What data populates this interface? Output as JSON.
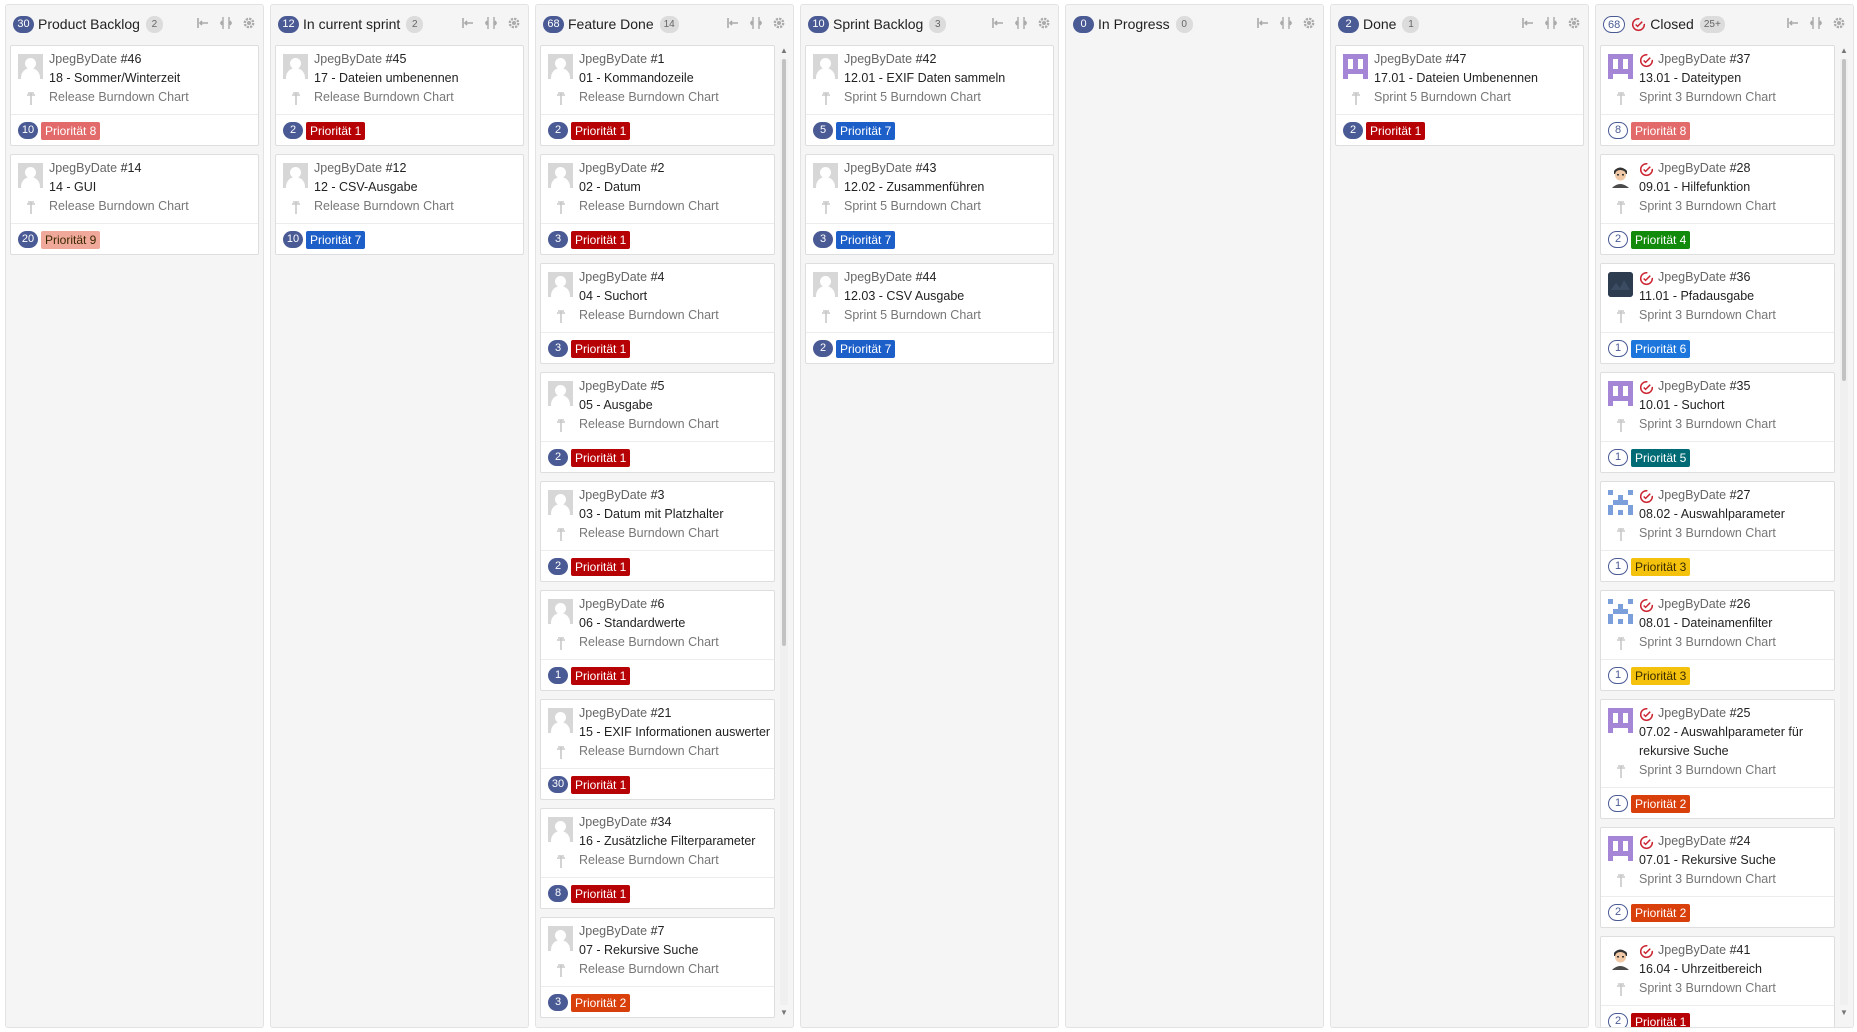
{
  "columns": [
    {
      "count": "30",
      "title": "Product Backlog",
      "badge": "2",
      "cards": [
        {
          "repo": "JpegByDate",
          "num": "#46",
          "title": "18 - Sommer/Winterzeit",
          "milestone": "Release Burndown Chart",
          "points": "10",
          "priority": "Priorität 8",
          "prio_color": "#e26a6a",
          "avatar": "gray"
        },
        {
          "repo": "JpegByDate",
          "num": "#14",
          "title": "14 - GUI",
          "milestone": "Release Burndown Chart",
          "points": "20",
          "priority": "Priorität 9",
          "prio_color": "#f0a89a",
          "avatar": "gray"
        }
      ]
    },
    {
      "count": "12",
      "title": "In current sprint",
      "badge": "2",
      "cards": [
        {
          "repo": "JpegByDate",
          "num": "#45",
          "title": "17 - Dateien umbenennen",
          "milestone": "Release Burndown Chart",
          "points": "2",
          "priority": "Priorität 1",
          "prio_color": "#b60205",
          "avatar": "gray"
        },
        {
          "repo": "JpegByDate",
          "num": "#12",
          "title": "12 - CSV-Ausgabe",
          "milestone": "Release Burndown Chart",
          "points": "10",
          "priority": "Priorität 7",
          "prio_color": "#1d5fc8",
          "avatar": "gray"
        }
      ]
    },
    {
      "count": "68",
      "title": "Feature Done",
      "badge": "14",
      "cards": [
        {
          "repo": "JpegByDate",
          "num": "#1",
          "title": "01 - Kommandozeile",
          "milestone": "Release Burndown Chart",
          "points": "2",
          "priority": "Priorität 1",
          "prio_color": "#b60205",
          "avatar": "gray"
        },
        {
          "repo": "JpegByDate",
          "num": "#2",
          "title": "02 - Datum",
          "milestone": "Release Burndown Chart",
          "points": "3",
          "priority": "Priorität 1",
          "prio_color": "#b60205",
          "avatar": "gray"
        },
        {
          "repo": "JpegByDate",
          "num": "#4",
          "title": "04 - Suchort",
          "milestone": "Release Burndown Chart",
          "points": "3",
          "priority": "Priorität 1",
          "prio_color": "#b60205",
          "avatar": "gray"
        },
        {
          "repo": "JpegByDate",
          "num": "#5",
          "title": "05 - Ausgabe",
          "milestone": "Release Burndown Chart",
          "points": "2",
          "priority": "Priorität 1",
          "prio_color": "#b60205",
          "avatar": "gray"
        },
        {
          "repo": "JpegByDate",
          "num": "#3",
          "title": "03 - Datum mit Platzhalter",
          "milestone": "Release Burndown Chart",
          "points": "2",
          "priority": "Priorität 1",
          "prio_color": "#b60205",
          "avatar": "gray"
        },
        {
          "repo": "JpegByDate",
          "num": "#6",
          "title": "06 - Standardwerte",
          "milestone": "Release Burndown Chart",
          "points": "1",
          "priority": "Priorität 1",
          "prio_color": "#b60205",
          "avatar": "gray"
        },
        {
          "repo": "JpegByDate",
          "num": "#21",
          "title": "15 - EXIF Informationen auswerten",
          "milestone": "Release Burndown Chart",
          "points": "30",
          "priority": "Priorität 1",
          "prio_color": "#b60205",
          "avatar": "gray"
        },
        {
          "repo": "JpegByDate",
          "num": "#34",
          "title": "16 - Zusätzliche Filterparameter",
          "milestone": "Release Burndown Chart",
          "points": "8",
          "priority": "Priorität 1",
          "prio_color": "#b60205",
          "avatar": "gray"
        },
        {
          "repo": "JpegByDate",
          "num": "#7",
          "title": "07 - Rekursive Suche",
          "milestone": "Release Burndown Chart",
          "points": "3",
          "priority": "Priorität 2",
          "prio_color": "#d93f0b",
          "avatar": "gray"
        }
      ]
    },
    {
      "count": "10",
      "title": "Sprint Backlog",
      "badge": "3",
      "cards": [
        {
          "repo": "JpegByDate",
          "num": "#42",
          "title": "12.01 - EXIF Daten sammeln",
          "milestone": "Sprint 5 Burndown Chart",
          "points": "5",
          "priority": "Priorität 7",
          "prio_color": "#1d5fc8",
          "avatar": "gray"
        },
        {
          "repo": "JpegByDate",
          "num": "#43",
          "title": "12.02 - Zusammenführen",
          "milestone": "Sprint 5 Burndown Chart",
          "points": "3",
          "priority": "Priorität 7",
          "prio_color": "#1d5fc8",
          "avatar": "gray"
        },
        {
          "repo": "JpegByDate",
          "num": "#44",
          "title": "12.03 - CSV Ausgabe",
          "milestone": "Sprint 5 Burndown Chart",
          "points": "2",
          "priority": "Priorität 7",
          "prio_color": "#1d5fc8",
          "avatar": "gray"
        }
      ]
    },
    {
      "count": "0",
      "title": "In Progress",
      "badge": "0",
      "cards": []
    },
    {
      "count": "2",
      "title": "Done",
      "badge": "1",
      "cards": [
        {
          "repo": "JpegByDate",
          "num": "#47",
          "title": "17.01 - Dateien Umbenennen",
          "milestone": "Sprint 5 Burndown Chart",
          "points": "2",
          "priority": "Priorität 1",
          "prio_color": "#b60205",
          "avatar": "ident-purple"
        }
      ]
    },
    {
      "count": "68",
      "title": "Closed",
      "badge": "25+",
      "closed": true,
      "cards": [
        {
          "repo": "JpegByDate",
          "num": "#37",
          "title": "13.01 - Dateitypen",
          "milestone": "Sprint 3 Burndown Chart",
          "points": "8",
          "priority": "Priorität 8",
          "prio_color": "#e26a6a",
          "avatar": "ident-purple"
        },
        {
          "repo": "JpegByDate",
          "num": "#28",
          "title": "09.01 - Hilfefunktion",
          "milestone": "Sprint 3 Burndown Chart",
          "points": "2",
          "priority": "Priorität 4",
          "prio_color": "#128a0c",
          "avatar": "face"
        },
        {
          "repo": "JpegByDate",
          "num": "#36",
          "title": "11.01 - Pfadausgabe",
          "milestone": "Sprint 3 Burndown Chart",
          "points": "1",
          "priority": "Priorität 6",
          "prio_color": "#1d76db",
          "avatar": "dark"
        },
        {
          "repo": "JpegByDate",
          "num": "#35",
          "title": "10.01 - Suchort",
          "milestone": "Sprint 3 Burndown Chart",
          "points": "1",
          "priority": "Priorität 5",
          "prio_color": "#006b75",
          "avatar": "ident-purple"
        },
        {
          "repo": "JpegByDate",
          "num": "#27",
          "title": "08.02 - Auswahlparameter",
          "milestone": "Sprint 3 Burndown Chart",
          "points": "1",
          "priority": "Priorität 3",
          "prio_color": "#f4c20d",
          "avatar": "ident-blue"
        },
        {
          "repo": "JpegByDate",
          "num": "#26",
          "title": "08.01 - Dateinamenfilter",
          "milestone": "Sprint 3 Burndown Chart",
          "points": "1",
          "priority": "Priorität 3",
          "prio_color": "#f4c20d",
          "avatar": "ident-blue"
        },
        {
          "repo": "JpegByDate",
          "num": "#25",
          "title": "07.02 - Auswahlparameter für rekursive Suche",
          "milestone": "Sprint 3 Burndown Chart",
          "points": "1",
          "priority": "Priorität 2",
          "prio_color": "#d93f0b",
          "avatar": "ident-purple"
        },
        {
          "repo": "JpegByDate",
          "num": "#24",
          "title": "07.01 - Rekursive Suche",
          "milestone": "Sprint 3 Burndown Chart",
          "points": "2",
          "priority": "Priorität 2",
          "prio_color": "#d93f0b",
          "avatar": "ident-purple"
        },
        {
          "repo": "JpegByDate",
          "num": "#41",
          "title": "16.04 - Uhrzeitbereich",
          "milestone": "Sprint 3 Burndown Chart",
          "points": "2",
          "priority": "Priorität 1",
          "prio_color": "#b60205",
          "avatar": "face"
        }
      ]
    }
  ],
  "colors": {
    "count_badge": "#4a5a94",
    "closed_icon": "#cb2431"
  },
  "icons": {
    "collapse": "collapse-icon",
    "compress": "compress-icon",
    "settings": "gear-icon",
    "milestone": "milestone-icon",
    "closed": "closed-issue-icon"
  }
}
